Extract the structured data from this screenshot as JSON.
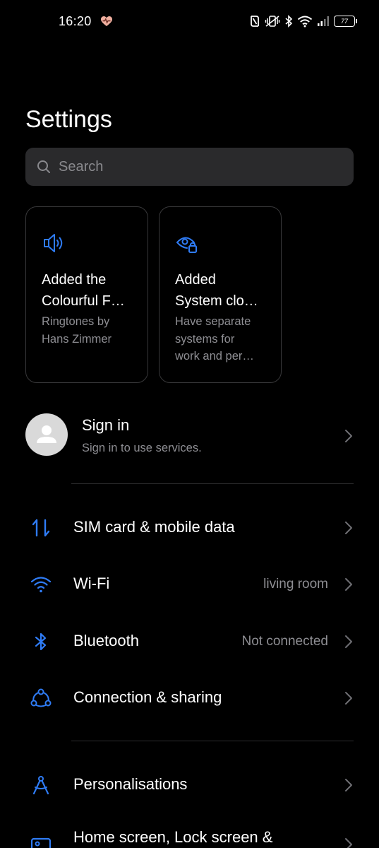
{
  "status_bar": {
    "time": "16:20",
    "battery": "77",
    "icons": [
      "heart-rate-icon",
      "nfc-icon",
      "vibrate-icon",
      "bluetooth-icon",
      "wifi-icon",
      "signal-icon",
      "battery-icon"
    ]
  },
  "page": {
    "title": "Settings"
  },
  "search": {
    "placeholder": "Search"
  },
  "cards": [
    {
      "icon": "speaker-icon",
      "title_line1": "Added the",
      "title_line2": "Colourful F…",
      "sub_line1": "Ringtones by",
      "sub_line2": "Hans Zimmer"
    },
    {
      "icon": "eye-lock-icon",
      "title_line1": "Added",
      "title_line2": "System clo…",
      "sub_line1": "Have separate",
      "sub_line2": "systems for",
      "sub_line3": "work and per…"
    }
  ],
  "account": {
    "title": "Sign in",
    "subtitle": "Sign in to use services."
  },
  "settings": [
    {
      "label": "SIM card & mobile data",
      "value": "",
      "icon": "sim-data-icon"
    },
    {
      "label": "Wi-Fi",
      "value": "living room",
      "icon": "wifi-icon"
    },
    {
      "label": "Bluetooth",
      "value": "Not connected",
      "icon": "bluetooth-icon"
    },
    {
      "label": "Connection & sharing",
      "value": "",
      "icon": "connection-sharing-icon"
    },
    {
      "label": "Personalisations",
      "value": "",
      "icon": "personalisation-icon"
    },
    {
      "label": "Home screen, Lock screen &",
      "value": "",
      "icon": "home-screen-icon"
    }
  ],
  "colors": {
    "accent": "#2f7cf6",
    "background": "#000000",
    "secondary_text": "#8e8e93",
    "search_bg": "#2a2a2c"
  }
}
